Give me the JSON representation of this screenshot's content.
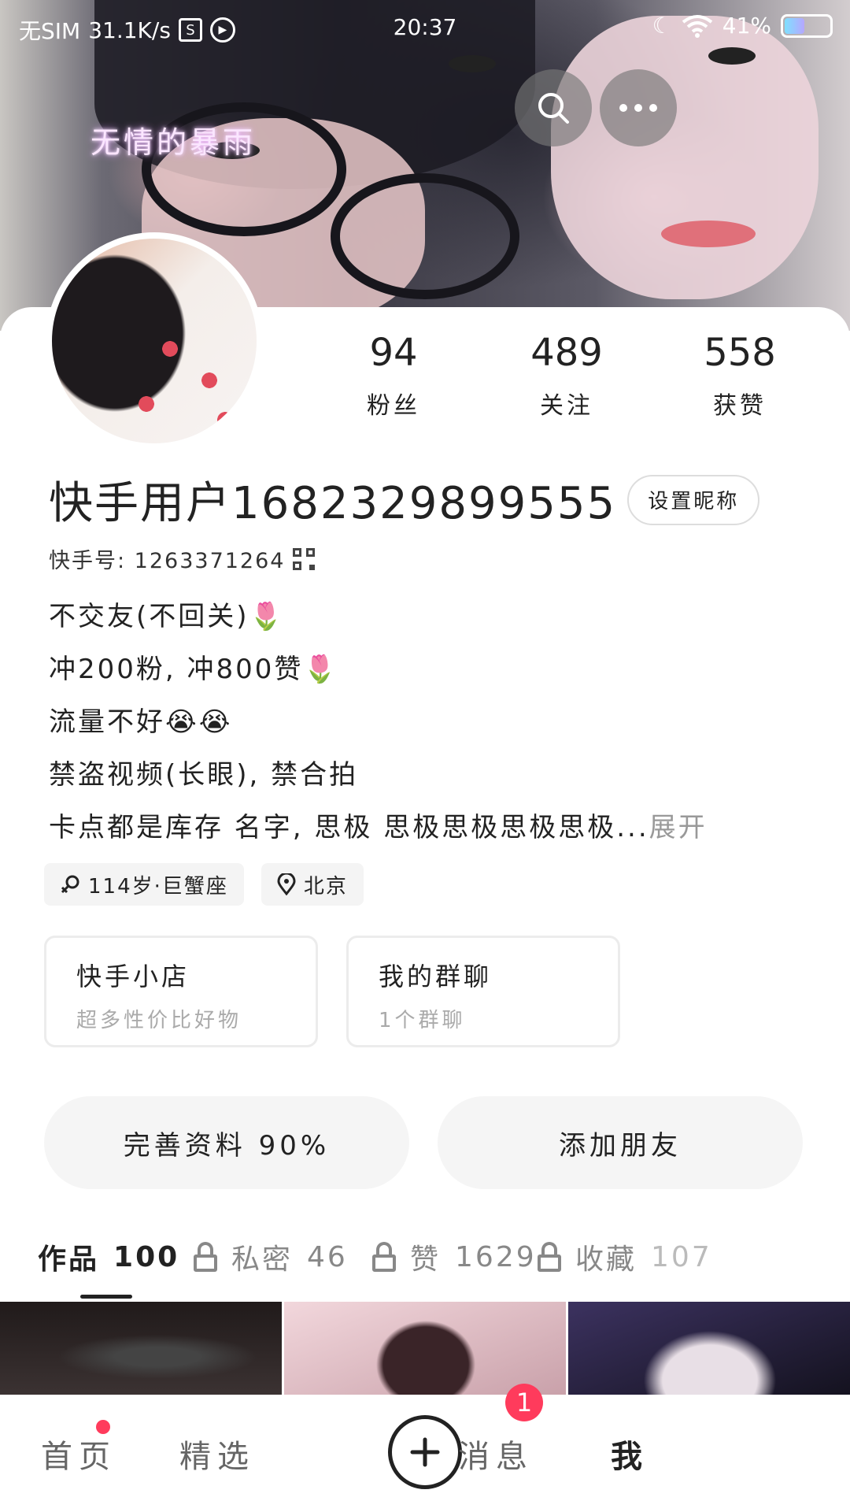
{
  "status_bar": {
    "carrier": "无SIM",
    "speed": "31.1K/s",
    "time": "20:37",
    "battery": "41%",
    "battery_level": 0.41
  },
  "cover": {
    "overlay_text": "无情的暴雨"
  },
  "profile": {
    "stats": [
      {
        "value": "94",
        "label": "粉丝"
      },
      {
        "value": "489",
        "label": "关注"
      },
      {
        "value": "558",
        "label": "获赞"
      }
    ],
    "username": "快手用户1682329899555",
    "set_nickname_label": "设置昵称",
    "kuaishou_id": "快手号: 1263371264",
    "bio_lines": [
      "不交友(不回关)🌷",
      "冲200粉, 冲800赞🌷",
      "流量不好😭😭",
      "禁盗视频(长眼), 禁合拍",
      "卡点都是库存 名字, 思极 思极思极思极思极..."
    ],
    "expand_label": "展开",
    "tags": [
      {
        "icon": "female-icon",
        "text": "114岁·巨蟹座"
      },
      {
        "icon": "location-pin-icon",
        "text": "北京"
      }
    ]
  },
  "feature_cards": [
    {
      "title": "快手小店",
      "subtitle": "超多性价比好物"
    },
    {
      "title": "我的群聊",
      "subtitle": "1个群聊"
    }
  ],
  "actions": {
    "complete_profile": "完善资料 90%",
    "add_friends": "添加朋友"
  },
  "tabs": [
    {
      "label": "作品",
      "count": "100",
      "locked": false,
      "active": true
    },
    {
      "label": "私密",
      "count": "46",
      "locked": true,
      "active": false
    },
    {
      "label": "赞",
      "count": "1629",
      "locked": true,
      "active": false
    },
    {
      "label": "收藏",
      "count": "107",
      "locked": true,
      "active": false
    }
  ],
  "bottom_nav": {
    "items": [
      {
        "label": "首页",
        "dot": true
      },
      {
        "label": "精选"
      },
      {
        "label": "消息",
        "badge": "1"
      },
      {
        "label": "我",
        "active": true
      }
    ]
  },
  "colors": {
    "accent_red": "#ff3b5c",
    "text_primary": "#222222",
    "text_muted": "#999999"
  }
}
